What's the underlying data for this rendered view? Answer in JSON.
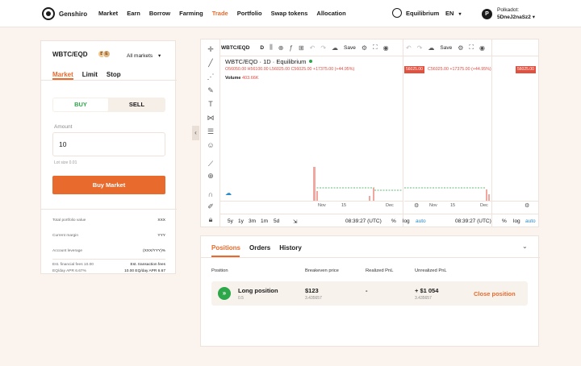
{
  "header": {
    "brand": "Genshiro",
    "nav": [
      "Market",
      "Earn",
      "Borrow",
      "Farming",
      "Trade",
      "Portfolio",
      "Swap tokens",
      "Allocation"
    ],
    "active_nav": "Trade",
    "network": "Equilibrium",
    "language": "EN",
    "account_label": "Polkadot:",
    "account_address": "5DneJ2naSz2",
    "account_icon_glyph": "P"
  },
  "order": {
    "pair": "WBTC/EQD",
    "coin1": "B",
    "coin2": "E",
    "market_select": "All markets",
    "tabs": [
      "Market",
      "Limit",
      "Stop"
    ],
    "active_tab": "Market",
    "buy_label": "BUY",
    "sell_label": "SELL",
    "amount_label": "Amount",
    "amount_value": "10",
    "lot_size": "Lot size 0.01",
    "submit_label": "Buy Market",
    "stats": [
      {
        "label": "Total portfolio value",
        "value": "XXX"
      },
      {
        "label": "Current margin",
        "value": "YYY"
      },
      {
        "label": "Account leverage",
        "value": "(XXX/YYY)%"
      }
    ],
    "fees": {
      "left_line1": "Est. financial fees 10.00",
      "left_line2": "EQ/day APR 6.67%",
      "right_line1": "Est. transaction fees",
      "right_line2": "10.00 EQ/day APR 6.67"
    }
  },
  "chart": {
    "toolbar_symbol": "WBTC/EQD",
    "toolbar_interval": "D",
    "save_label": "Save",
    "legend": "WBTC/EQD · 1D · Equilibrium",
    "ohlc": "O56050.00 H56100.00 L56025.00 C56025.00 +17375.00 (+44.95%)",
    "ohlc_short": "C56025.00 +17375.00 (+44.95%)",
    "volume_label": "Volume",
    "volume_value": "403.66K",
    "price_tag": "56025.00",
    "x_ticks_1": [
      "Nov",
      "15",
      "Dec"
    ],
    "x_ticks_2": [
      "Nov",
      "15",
      "Dec"
    ],
    "ranges": [
      "5y",
      "1y",
      "3m",
      "1m",
      "5d"
    ],
    "time": "08:39:27 (UTC)",
    "pct": "%",
    "log": "log",
    "auto": "auto"
  },
  "chart_data": {
    "type": "bar",
    "title": "WBTC/EQD · 1D · Equilibrium",
    "series": [
      {
        "name": "Volume",
        "values": [
          403.66
        ]
      }
    ]
  },
  "positions": {
    "tabs": [
      "Positions",
      "Orders",
      "History"
    ],
    "active_tab": "Positions",
    "columns": [
      "Position",
      "Breakeven price",
      "Realized PnL",
      "Unrealized PnL"
    ],
    "row": {
      "name": "Long position",
      "size": "0.5",
      "breakeven": "$123",
      "breakeven_sub": "3.435657",
      "realized": "-",
      "unrealized": "+ $1 054",
      "unrealized_sub": "3.435657",
      "action": "Close position"
    }
  }
}
